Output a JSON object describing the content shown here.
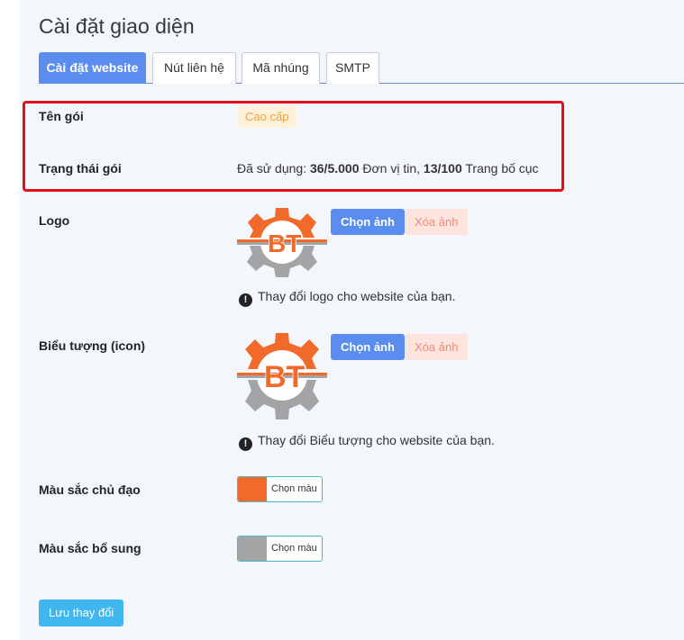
{
  "page": {
    "title": "Cài đặt giao diện"
  },
  "tabs": [
    {
      "label": "Cài đặt website",
      "active": true
    },
    {
      "label": "Nút liên hệ",
      "active": false
    },
    {
      "label": "Mã nhúng",
      "active": false
    },
    {
      "label": "SMTP",
      "active": false
    }
  ],
  "package": {
    "name_label": "Tên gói",
    "name_value": "Cao cấp",
    "status_label": "Trạng thái gói",
    "status_prefix": "Đã sử dụng: ",
    "units_used": "36/5.000",
    "units_text": " Đơn vị tin, ",
    "layouts_used": "13/100",
    "layouts_text": " Trang bố cục"
  },
  "logo": {
    "label": "Logo",
    "choose_label": "Chọn ảnh",
    "delete_label": "Xóa ảnh",
    "hint": "Thay đổi logo cho website của bạn."
  },
  "icon": {
    "label": "Biểu tượng (icon)",
    "choose_label": "Chọn ảnh",
    "delete_label": "Xóa ảnh",
    "hint": "Thay đổi Biểu tượng cho website của bạn."
  },
  "logo_text": "BT",
  "colors": {
    "primary_label": "Màu sắc chủ đạo",
    "primary_value": "#f26a2a",
    "secondary_label": "Màu sắc bổ sung",
    "secondary_value": "#a3a4a6",
    "picker_label": "Chọn màu"
  },
  "save_label": "Lưu thay đổi",
  "theme": {
    "accent": "#5b8def",
    "highlight": "#e3101a",
    "logo_orange": "#f26a2a",
    "logo_gray": "#a3a4a6"
  }
}
